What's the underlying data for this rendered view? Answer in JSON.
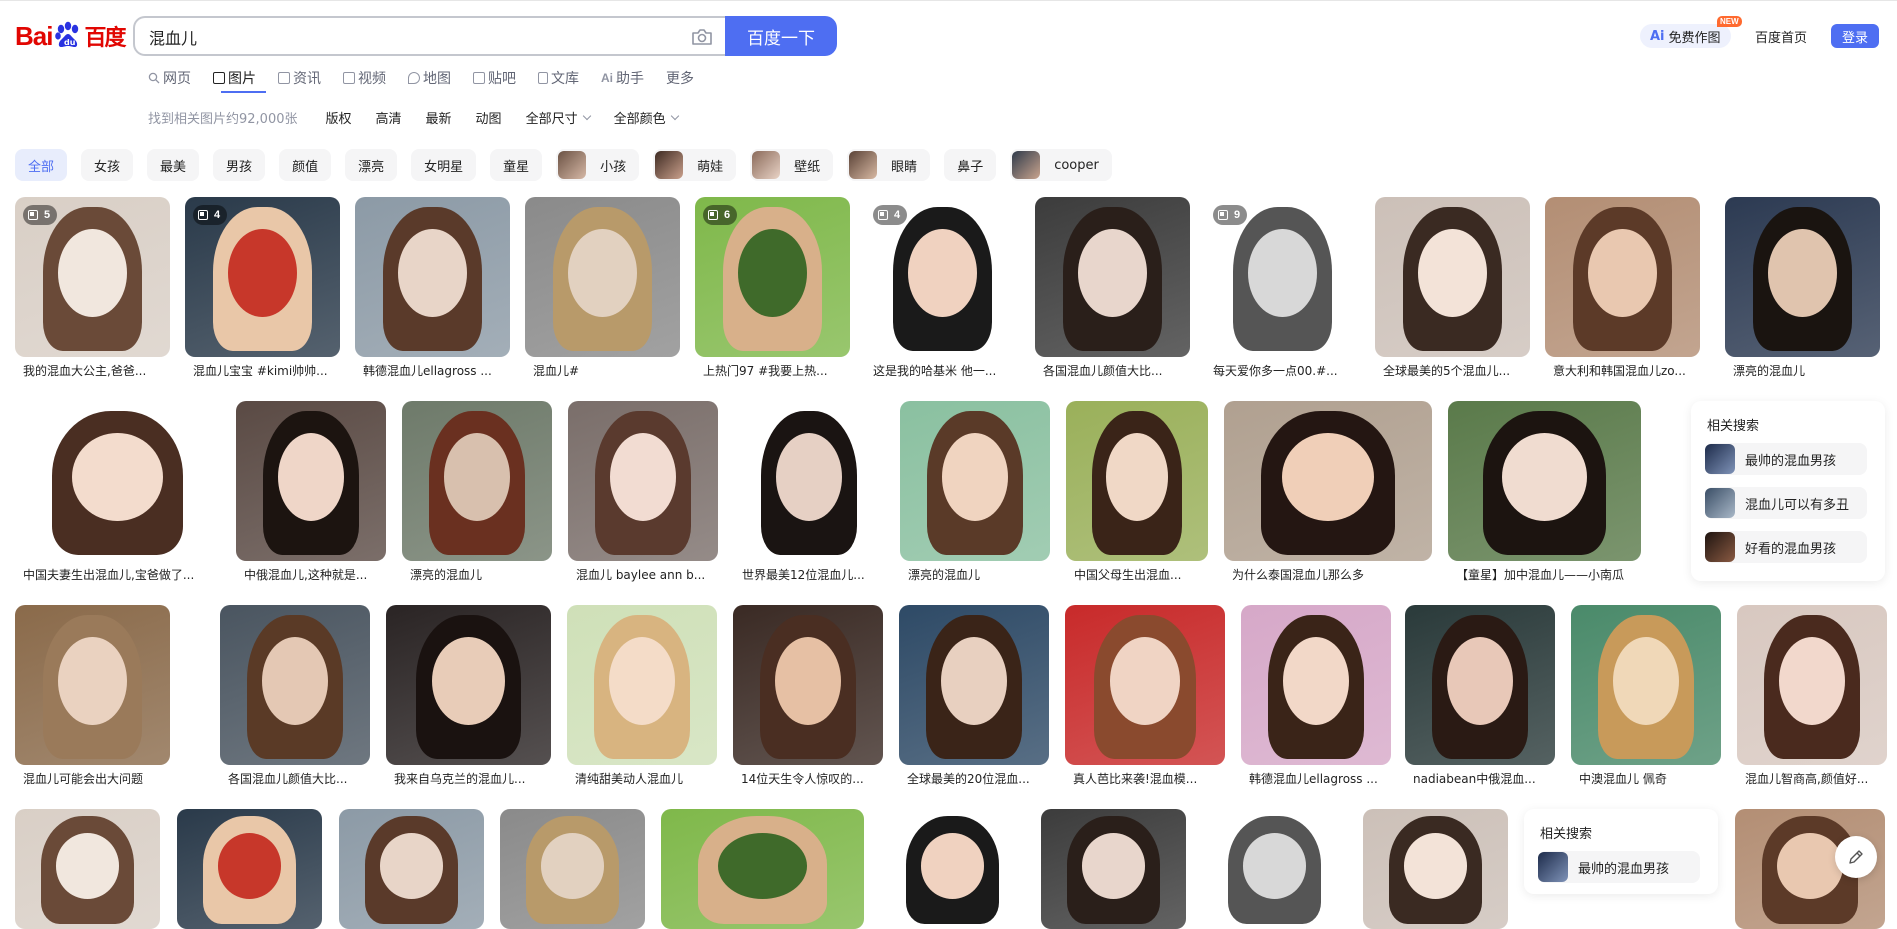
{
  "header": {
    "logo_latin": "Bai",
    "logo_cn": "百度",
    "search_value": "混血儿",
    "search_button": "百度一下",
    "ai_draw_label": "免费作图",
    "ai_prefix": "Ai",
    "new_badge": "NEW",
    "home_link": "百度首页",
    "login_button": "登录"
  },
  "tabs": [
    {
      "label": "网页",
      "icon": "search-icon"
    },
    {
      "label": "图片",
      "icon": "image-icon",
      "active": true
    },
    {
      "label": "资讯",
      "icon": "news-icon"
    },
    {
      "label": "视频",
      "icon": "video-icon"
    },
    {
      "label": "地图",
      "icon": "map-icon"
    },
    {
      "label": "贴吧",
      "icon": "tieba-icon"
    },
    {
      "label": "文库",
      "icon": "doc-icon"
    },
    {
      "label": "助手",
      "icon": "ai-icon"
    },
    {
      "label": "更多",
      "icon": ""
    }
  ],
  "filters": {
    "count": "找到相关图片约92,000张",
    "items": [
      "版权",
      "高清",
      "最新",
      "动图"
    ],
    "size": "全部尺寸",
    "color": "全部颜色"
  },
  "chips": [
    {
      "label": "全部",
      "active": true
    },
    {
      "label": "女孩"
    },
    {
      "label": "最美"
    },
    {
      "label": "男孩"
    },
    {
      "label": "颜值"
    },
    {
      "label": "漂亮"
    },
    {
      "label": "女明星"
    },
    {
      "label": "童星"
    },
    {
      "label": "小孩",
      "thumb": true
    },
    {
      "label": "萌娃",
      "thumb": true
    },
    {
      "label": "壁纸",
      "thumb": true
    },
    {
      "label": "眼睛",
      "thumb": true
    },
    {
      "label": "鼻子"
    },
    {
      "label": "cooper",
      "thumb": true
    }
  ],
  "row1": [
    {
      "caption": "我的混血大公主,爸爸...",
      "badge": "5"
    },
    {
      "caption": "混血儿宝宝 #kimi帅帅...",
      "badge": "4"
    },
    {
      "caption": "韩德混血儿ellagross ...",
      "badge": ""
    },
    {
      "caption": "混血儿#",
      "badge": ""
    },
    {
      "caption": "上热门97 #我要上热...",
      "badge": "6"
    },
    {
      "caption": "这是我的哈基米 他一...",
      "badge": "4"
    },
    {
      "caption": "各国混血儿颜值大比...",
      "badge": ""
    },
    {
      "caption": "每天爱你多一点00.#...",
      "badge": "9"
    },
    {
      "caption": "全球最美的5个混血儿...",
      "badge": ""
    },
    {
      "caption": "意大利和韩国混血儿zo...",
      "badge": ""
    },
    {
      "caption": "漂亮的混血儿",
      "badge": ""
    }
  ],
  "row2": [
    {
      "caption": "中国夫妻生出混血儿,宝爸做了..."
    },
    {
      "caption": "中俄混血儿,这种就是..."
    },
    {
      "caption": "漂亮的混血儿"
    },
    {
      "caption": "混血儿 baylee ann b..."
    },
    {
      "caption": "世界最美12位混血儿..."
    },
    {
      "caption": "漂亮的混血儿"
    },
    {
      "caption": "中国父母生出混血..."
    },
    {
      "caption": "为什么泰国混血儿那么多"
    },
    {
      "caption": "【童星】加中混血儿——小南瓜"
    }
  ],
  "row3": [
    {
      "caption": "混血儿可能会出大问题"
    },
    {
      "caption": "各国混血儿颜值大比..."
    },
    {
      "caption": "我来自乌克兰的混血儿..."
    },
    {
      "caption": "清纯甜美动人混血儿"
    },
    {
      "caption": "14位天生令人惊叹的..."
    },
    {
      "caption": "全球最美的20位混血..."
    },
    {
      "caption": "真人芭比来袭!混血模..."
    },
    {
      "caption": "韩德混血儿ellagross ..."
    },
    {
      "caption": "nadiabean中俄混血..."
    },
    {
      "caption": "中澳混血儿 佩奇"
    },
    {
      "caption": "混血儿智商高,颜值好..."
    }
  ],
  "related1": {
    "title": "相关搜索",
    "items": [
      "最帅的混血男孩",
      "混血儿可以有多丑",
      "好看的混血男孩"
    ]
  },
  "related2": {
    "title": "相关搜索",
    "items": [
      "最帅的混血男孩"
    ]
  },
  "colors": {
    "brand_blue": "#4e6ef2",
    "logo_red": "#e10602",
    "chip_bg": "#f5f5f6"
  }
}
